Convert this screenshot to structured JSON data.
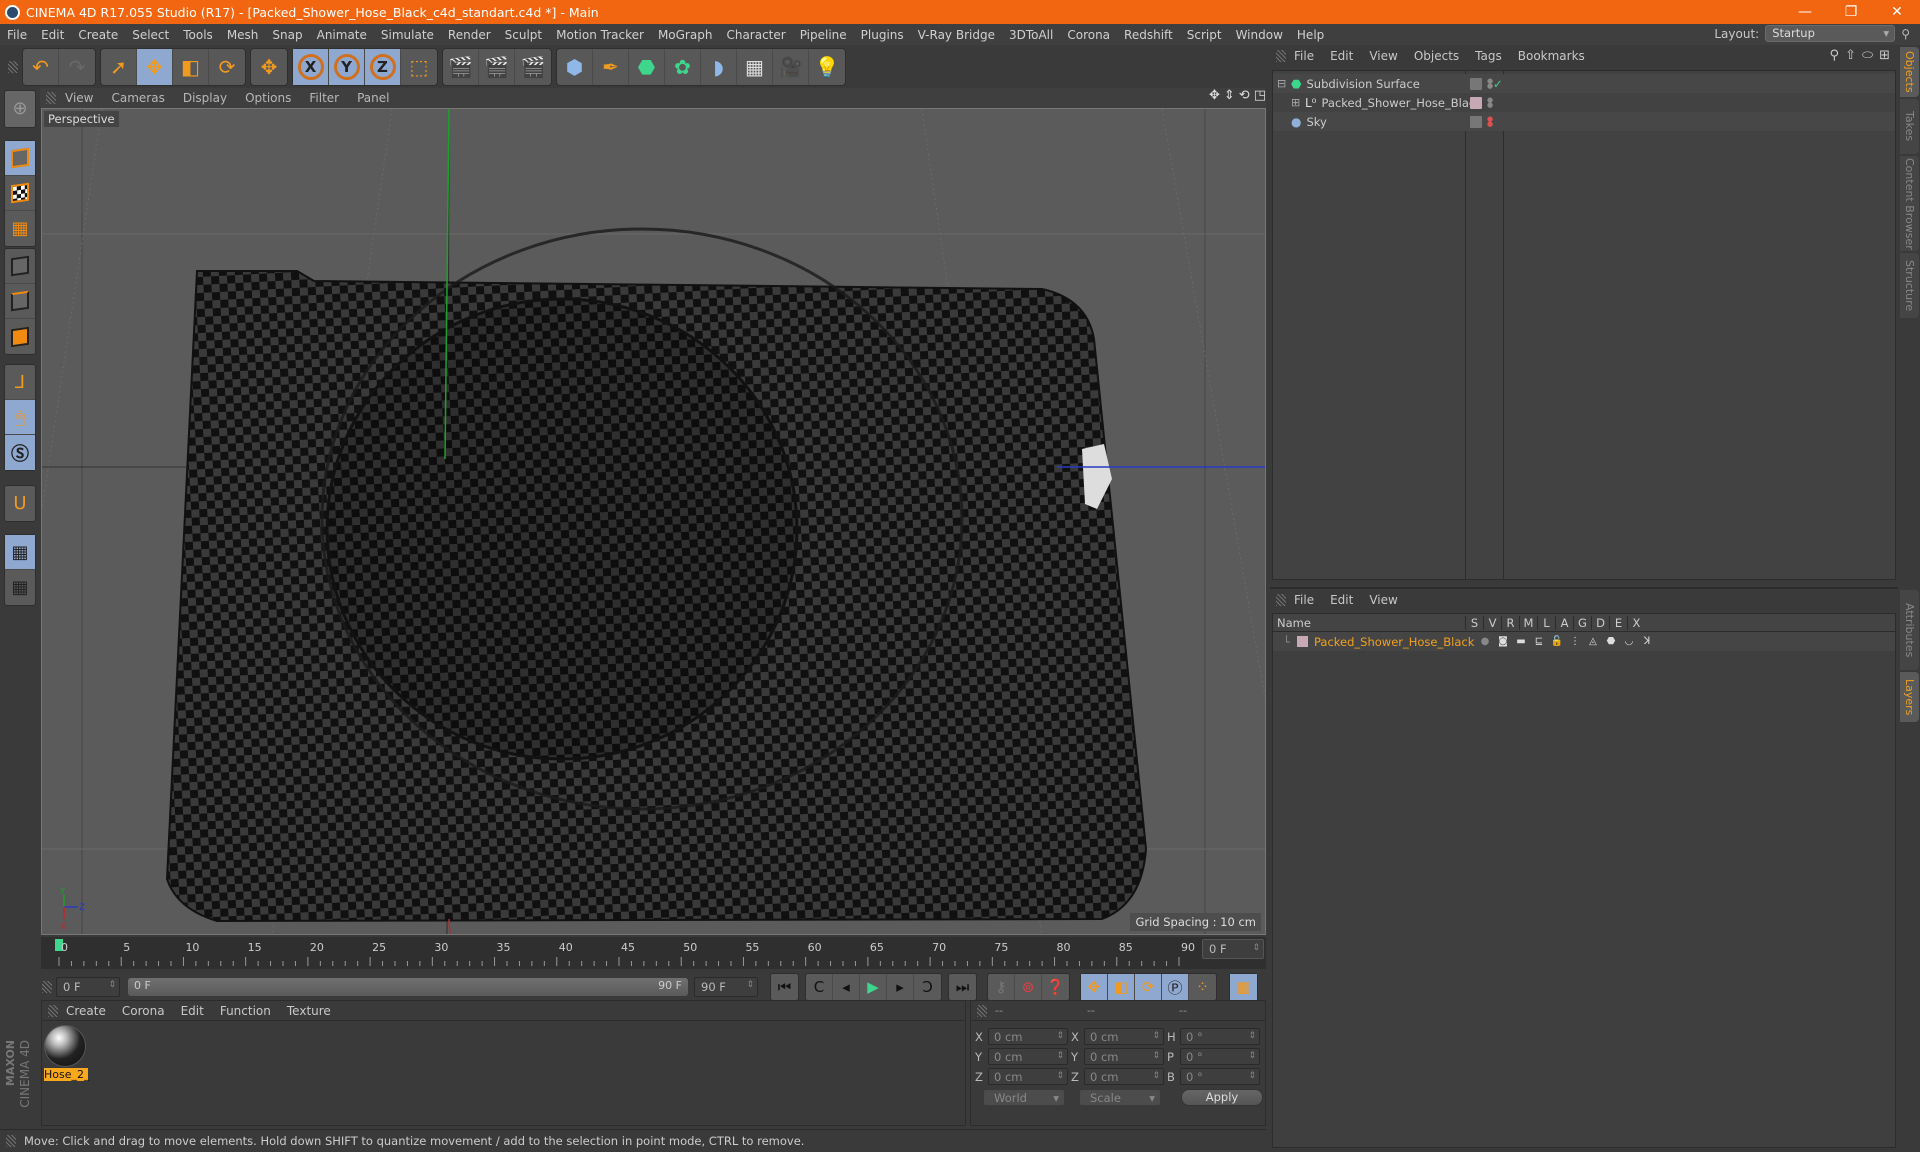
{
  "window": {
    "title": "CINEMA 4D R17.055 Studio (R17) - [Packed_Shower_Hose_Black_c4d_standart.c4d *] - Main",
    "controls": {
      "minimize": "—",
      "maximize": "❐",
      "close": "✕"
    }
  },
  "menubar": {
    "items": [
      "File",
      "Edit",
      "Create",
      "Select",
      "Tools",
      "Mesh",
      "Snap",
      "Animate",
      "Simulate",
      "Render",
      "Sculpt",
      "Motion Tracker",
      "MoGraph",
      "Character",
      "Pipeline",
      "Plugins",
      "V-Ray Bridge",
      "3DToAll",
      "Corona",
      "Redshift",
      "Script",
      "Window",
      "Help"
    ],
    "layout_label": "Layout:",
    "layout_value": "Startup"
  },
  "toolbar": {
    "groups": [
      [
        {
          "icon": "undo-icon",
          "glyph": "↶"
        },
        {
          "icon": "redo-icon",
          "glyph": "↷",
          "disabled": true
        }
      ],
      [
        {
          "icon": "select-arrow-icon",
          "glyph": "➚",
          "active": false
        },
        {
          "icon": "move-icon",
          "glyph": "✥",
          "active": true
        },
        {
          "icon": "scale-icon",
          "glyph": "◧"
        },
        {
          "icon": "rotate-icon",
          "glyph": "⟳"
        }
      ],
      [
        {
          "icon": "last-tool-icon",
          "glyph": "✥"
        }
      ],
      [
        {
          "icon": "x-axis-icon",
          "glyph": "X",
          "axis": true
        },
        {
          "icon": "y-axis-icon",
          "glyph": "Y",
          "axis": true
        },
        {
          "icon": "z-axis-icon",
          "glyph": "Z",
          "axis": true
        },
        {
          "icon": "coordinate-system-icon",
          "glyph": "⬚"
        }
      ],
      [
        {
          "icon": "render-view-icon",
          "glyph": "🎬"
        },
        {
          "icon": "render-picture-viewer-icon",
          "glyph": "🎬"
        },
        {
          "icon": "render-settings-icon",
          "glyph": "🎬"
        }
      ],
      [
        {
          "icon": "cube-primitive-icon",
          "glyph": "⬢"
        },
        {
          "icon": "pen-spline-icon",
          "glyph": "✒"
        },
        {
          "icon": "subdivision-surface-icon",
          "glyph": "⬣"
        },
        {
          "icon": "cloner-icon",
          "glyph": "✿"
        },
        {
          "icon": "deformer-icon",
          "glyph": "◗"
        },
        {
          "icon": "floor-scene-icon",
          "glyph": "▦"
        },
        {
          "icon": "camera-icon",
          "glyph": "🎥"
        },
        {
          "icon": "light-icon",
          "glyph": "💡"
        }
      ]
    ]
  },
  "left_toolbar": {
    "items": [
      "make-editable-icon",
      "model-mode-icon",
      "texture-mode-icon",
      "workplane-mode-icon",
      "points-mode-icon",
      "edges-mode-icon",
      "polygons-mode-icon",
      "axis-mode-icon",
      "tweak-mode-icon",
      "solo-mode-icon",
      "snapping-icon",
      "locked-workplane-icon",
      "planar-workplane-icon"
    ]
  },
  "viewport": {
    "menu": [
      "View",
      "Cameras",
      "Display",
      "Options",
      "Filter",
      "Panel"
    ],
    "camera_label": "Perspective",
    "grid_spacing": "Grid Spacing : 10 cm",
    "axis_labels": {
      "y": "Y",
      "z": "Z",
      "x": "X"
    }
  },
  "timeline": {
    "ticks": [
      "0",
      "5",
      "10",
      "15",
      "20",
      "25",
      "30",
      "35",
      "40",
      "45",
      "50",
      "55",
      "60",
      "65",
      "70",
      "75",
      "80",
      "85",
      "90"
    ],
    "current_frame": "0 F",
    "start_field": "0 F",
    "scrub_start": "0 F",
    "scrub_end": "90 F",
    "end_field": "90 F"
  },
  "playback": {
    "buttons": [
      "go-to-start-icon",
      "go-to-previous-key-icon",
      "step-back-icon",
      "play-icon",
      "step-forward-icon",
      "go-to-next-key-icon",
      "go-to-end-icon"
    ],
    "key_buttons": [
      "record-keys-disabled-icon",
      "autokey-icon",
      "keyframe-selection-icon"
    ],
    "track_buttons": [
      "position-track-icon",
      "scale-track-icon",
      "rotation-track-icon",
      "parameter-track-icon",
      "point-level-animation-icon"
    ],
    "timeline_button": "timeline-window-icon"
  },
  "material_manager": {
    "menu": [
      "Create",
      "Corona",
      "Edit",
      "Function",
      "Texture"
    ],
    "materials": [
      {
        "name": "Hose_2_"
      }
    ]
  },
  "brand": {
    "maxon": "MAXON",
    "product": "CINEMA 4D"
  },
  "coordinates": {
    "header": [
      "--",
      "--",
      "--"
    ],
    "rows": [
      {
        "a1": "X",
        "v1": "0 cm",
        "a2": "X",
        "v2": "0 cm",
        "a3": "H",
        "v3": "0 °"
      },
      {
        "a1": "Y",
        "v1": "0 cm",
        "a2": "Y",
        "v2": "0 cm",
        "a3": "P",
        "v3": "0 °"
      },
      {
        "a1": "Z",
        "v1": "0 cm",
        "a2": "Z",
        "v2": "0 cm",
        "a3": "B",
        "v3": "0 °"
      }
    ],
    "mode_dropdown": "World",
    "transform_dropdown": "Scale",
    "apply_label": "Apply"
  },
  "status_bar": {
    "text": "Move: Click and drag to move elements. Hold down SHIFT to quantize movement / add to the selection in point mode, CTRL to remove."
  },
  "object_manager": {
    "menu": [
      "File",
      "Edit",
      "View",
      "Objects",
      "Tags",
      "Bookmarks"
    ],
    "objects": [
      {
        "name": "Subdivision Surface",
        "icon": "subdivision-surface-icon",
        "expander": "⊟",
        "check": "✓"
      },
      {
        "name": "Packed_Shower_Hose_Black",
        "icon": "null-object-icon",
        "expander": "⊞",
        "tag_color": "#c7a9b5"
      },
      {
        "name": "Sky",
        "icon": "sky-icon",
        "expander": ""
      }
    ]
  },
  "layer_manager": {
    "menu": [
      "File",
      "Edit",
      "View"
    ],
    "columns": [
      "Name",
      "S",
      "V",
      "R",
      "M",
      "L",
      "A",
      "G",
      "D",
      "E",
      "X"
    ],
    "layers": [
      {
        "name": "Packed_Shower_Hose_Black",
        "color": "#c7a9b5",
        "name_color": "#f0a020"
      }
    ]
  },
  "side_tabs": {
    "top": [
      {
        "label": "Objects",
        "active": true
      },
      {
        "label": "Takes"
      },
      {
        "label": "Content Browser"
      },
      {
        "label": "Structure"
      }
    ],
    "bottom": [
      {
        "label": "Attributes"
      },
      {
        "label": "Layers",
        "active": true
      }
    ]
  },
  "colors": {
    "title_bar": "#f26511",
    "accent_orange": "#f09a20",
    "active_button": "#8fa8d0",
    "x_axis": "#c0282a",
    "y_axis": "#1ea02a",
    "z_axis": "#2a3ac0"
  }
}
